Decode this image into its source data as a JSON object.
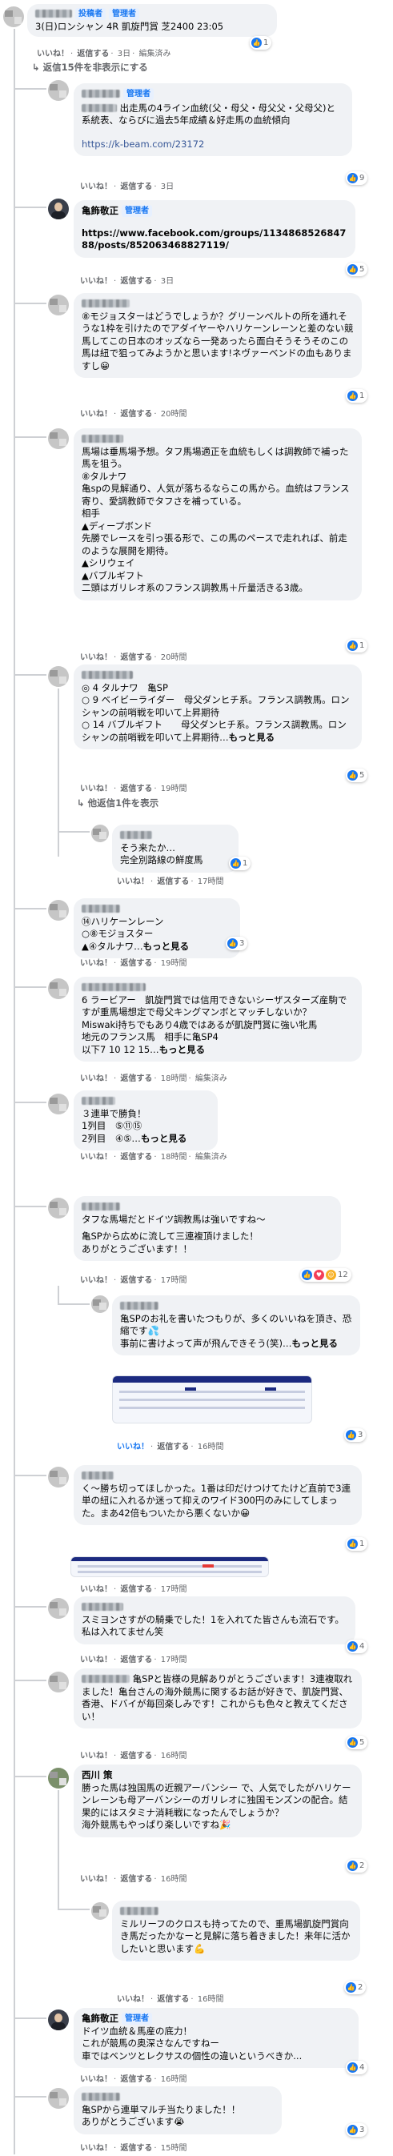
{
  "top": {
    "name_badge1": "投稿者",
    "name_badge2": "管理者",
    "text": "3(日)ロンシャン 4R 凱旋門賞 芝2400 23:05",
    "meta_like": "いいね！",
    "meta_reply": "返信する",
    "meta_time": "3日",
    "meta_edit": "編集済み",
    "react_count": "1"
  },
  "hidden_replies": "返信15件を非表示にする",
  "comments": [
    {
      "badge": "管理者",
      "lines": [
        "出走馬の4ライン血統(父・母父・母父父・父母父)と系統表、ならびに過去5年成績＆好走馬の血統傾向"
      ],
      "link": "https://k-beam.com/23172",
      "time": "3日",
      "react": "9"
    },
    {
      "name": "亀飾敬正",
      "badge": "管理者",
      "link": "https://www.facebook.com/groups/113486852684788/posts/852063468827119/",
      "time": "3日",
      "react": "5"
    },
    {
      "lines": [
        "⑧モジョスターはどうでしょうか？グリーンベルトの所を通れそうな1枠を引けたのでアダイヤーやハリケーンレーンと差のない競馬してこの日本のオッズなら一発あったら面白そうそうそのこの馬は紐で狙ってみようかと思います!ネヴァーベンドの血もありますし😀"
      ],
      "time": "20時間",
      "react": "1"
    },
    {
      "lines": [
        "馬場は垂馬場予想。タフ馬場適正を血統もしくは調教師で補った馬を狙う。",
        "⑧タルナワ",
        "亀spの見解通り、人気が落ちるならこの馬から。血統はフランス寄り、愛調教師でタフさを補っている。",
        "相手",
        "▲ディープボンド",
        "先勝でレースを引っ張る形で、この馬のペースで走れれば、前走のような展開を期待。",
        "▲シリウェイ",
        "▲バブルギフト",
        "二頭はガリレオ系のフランス調教馬＋斤量活きる3歳。"
      ],
      "time": "20時間",
      "react": "1"
    },
    {
      "lines": [
        "◎ 4 タルナワ　亀SP",
        "○ 9 ベイビーライダー　母父ダンヒチ系。フランス調教馬。ロンシャンの前哨戦を叩いて上昇期待",
        "○ 14 バブルギフト　　母父ダンヒチ系。フランス調教馬。ロンシャンの前哨戦を叩いて上昇期待…"
      ],
      "more": "もっと見る",
      "time": "19時間",
      "react": "5"
    }
  ],
  "view_replies": "他返信1件を表示",
  "sub_reply": {
    "lines": [
      "そう来たか…",
      "完全別路線の鮮度馬"
    ],
    "time": "17時間",
    "react": "1"
  },
  "comments2": [
    {
      "lines": [
        "⑭ハリケーンレーン",
        "○⑧モジョスター",
        "▲④タルナワ…"
      ],
      "more": "もっと見る",
      "time": "19時間",
      "react": "3"
    },
    {
      "lines": [
        "6 ラービアー　凱旋門賞では信用できないシーザスターズ産駒ですが重馬場想定で母父キングマンボとマッチしないか？　Miswaki持ちでもあり4歳ではあるが凱旋門賞に強い牝馬",
        "地元のフランス馬　相手に亀SP4",
        "以下7 10 12 15…"
      ],
      "more": "もっと見る",
      "time": "18時間",
      "edit": "編集済み"
    },
    {
      "lines": [
        "３連単で勝負！",
        "1列目　⑤⑪⑮",
        "2列目　④⑤…"
      ],
      "more": "もっと見る",
      "time": "18時間",
      "edit": "編集済み"
    },
    {
      "lines": [
        "タフな馬場だとドイツ調教馬は強いですね〜",
        "亀SPから広めに流して三連複頂けました！",
        "ありがとうございます！！"
      ],
      "time": "17時間",
      "react": "12"
    },
    {
      "lines": [
        "亀SPのお礼を書いたつもりが、多くのいいねを頂き、恐縮です💦",
        "事前に書けよって声が飛んできそう(笑)…"
      ],
      "more": "もっと見る",
      "time": "16時間",
      "react": "3"
    },
    {
      "lines": [
        "く〜勝ち切ってほしかった。1番は印だけつけてたけど直前で3連単の紐に入れるか迷って抑えのワイド300円のみにしてしまった。まあ42倍もついたから悪くないか😀"
      ],
      "time": "17時間",
      "react": "1"
    },
    {
      "lines": [
        "スミヨンさすがの騎乗でした！1を入れてた皆さんも流石です。私は入れてません笑"
      ],
      "time": "17時間",
      "react": "4"
    },
    {
      "lines": [
        "亀SPと皆様の見解ありがとうございます！3連複取れました！亀台さんの海外競馬に関するお話が好きで、凱旋門賞、香港、ドバイが毎回楽しみです！これからも色々と教えてください！"
      ],
      "time": "16時間",
      "react": "5"
    },
    {
      "name": "西川 策",
      "lines": [
        "勝った馬は独国馬の近親アーバンシー で、人気でしたがハリケーンレーンも母アーバンシーのガリレオに独国モンズンの配合。結果的にはスタミナ消耗戦になったんでしょうか？",
        "海外競馬もやっぱり楽しいですね🎉"
      ],
      "time": "16時間",
      "react": "2"
    },
    {
      "lines": [
        "ミルリーフのクロスも持ってたので、重馬場凱旋門賞向き馬だったかなーと見解に落ち着きました！来年に活かしたいと思います💪"
      ],
      "time": "16時間",
      "react": "2"
    },
    {
      "name": "亀飾敬正",
      "badge": "管理者",
      "lines": [
        "ドイツ血統＆馬産の底力！",
        "これが競馬の奥深さなんですねー",
        "車ではベンツとレクサスの個性の違いというべきか..."
      ],
      "time": "16時間",
      "react": "4"
    },
    {
      "lines": [
        "亀SPから連単マルチ当たりました！！",
        "ありがとうございます😭"
      ],
      "time": "15時間",
      "react": "3"
    }
  ],
  "ui": {
    "like": "いいね！",
    "reply": "返信する",
    "edited": "編集済み",
    "dot": "·"
  }
}
